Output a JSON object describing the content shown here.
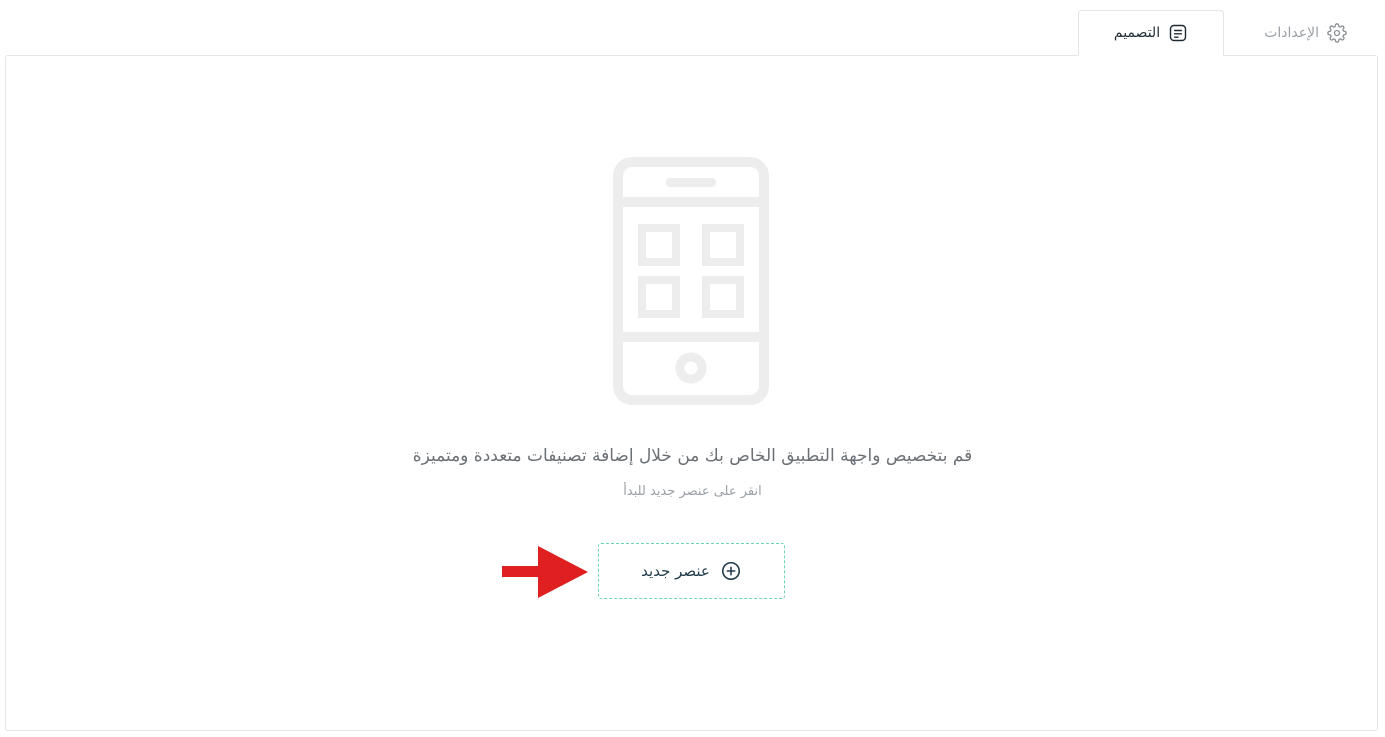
{
  "tabs": {
    "settings": {
      "label": "الإعدادات",
      "icon": "gear-icon"
    },
    "design": {
      "label": "التصميم",
      "icon": "document-icon",
      "active": true
    }
  },
  "empty_state": {
    "illustration": "phone-grid-icon",
    "headline": "قم بتخصيص واجهة التطبيق الخاص بك من خلال إضافة تصنيفات متعددة ومتميزة",
    "subline": "انقر على عنصر جديد للبدأ",
    "button_label": "عنصر جديد",
    "button_icon": "plus-circle-icon"
  },
  "colors": {
    "accent_dashed_border": "#6fd3b5",
    "arrow": "#e02020",
    "illustration": "#f0f0f0"
  }
}
